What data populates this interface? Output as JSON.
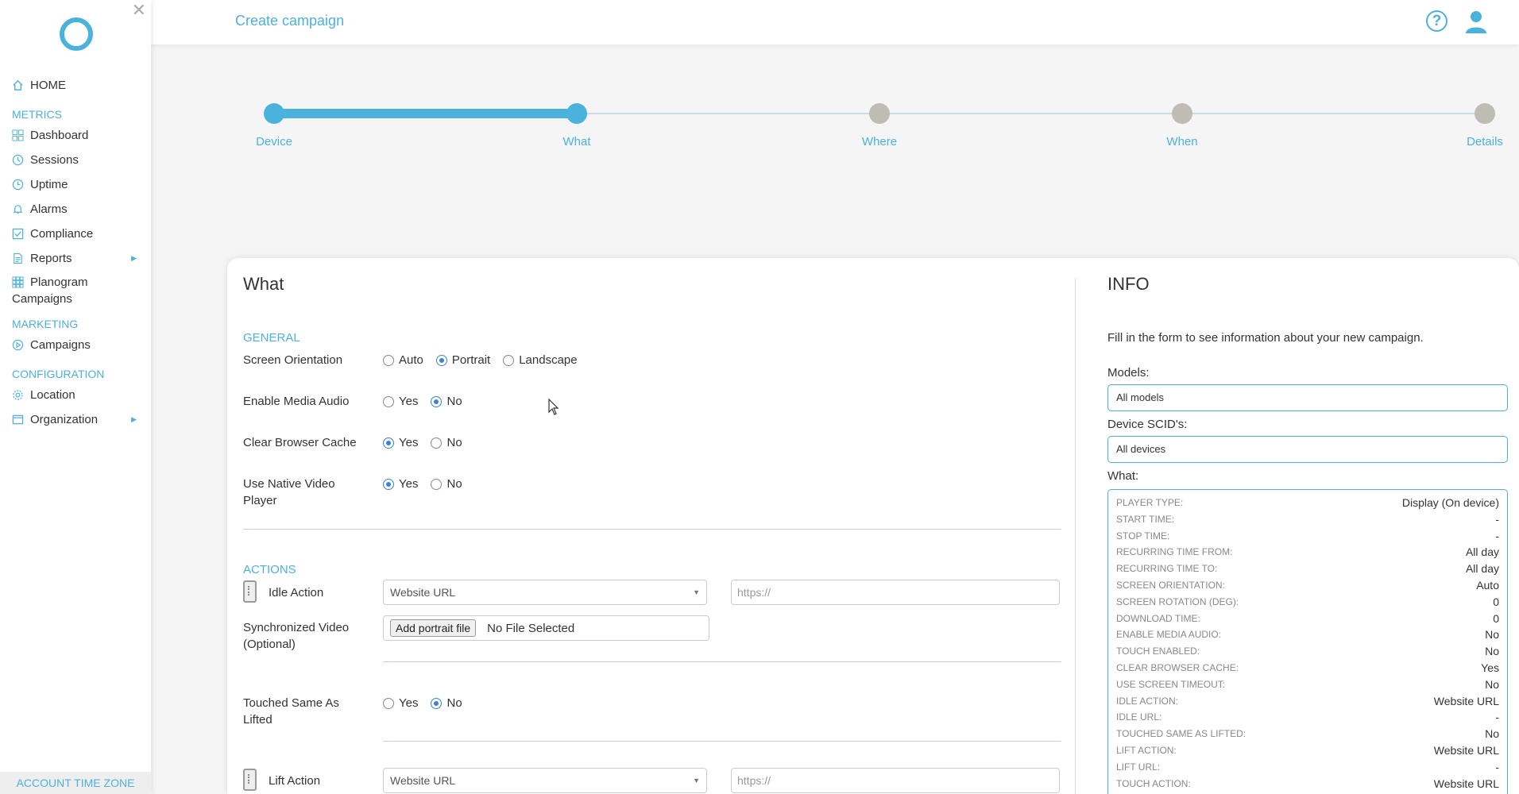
{
  "sidebar": {
    "home": "HOME",
    "sections": {
      "metrics": "METRICS",
      "marketing": "MARKETING",
      "configuration": "CONFIGURATION"
    },
    "metrics_items": [
      "Dashboard",
      "Sessions",
      "Uptime",
      "Alarms",
      "Compliance",
      "Reports"
    ],
    "planogram_line1": "Planogram",
    "planogram_line2": "Campaigns",
    "marketing_items": [
      "Campaigns"
    ],
    "configuration_items": [
      "Location",
      "Organization"
    ],
    "account_time_zone": "ACCOUNT TIME ZONE"
  },
  "header": {
    "title": "Create campaign",
    "help_glyph": "?"
  },
  "stepper": {
    "steps": [
      "Device",
      "What",
      "Where",
      "When",
      "Details"
    ],
    "current_step": 2
  },
  "form": {
    "title": "What",
    "general_section": "GENERAL",
    "screen_orientation": {
      "label": "Screen Orientation",
      "options": [
        "Auto",
        "Portrait",
        "Landscape"
      ],
      "selected": "Portrait"
    },
    "enable_media_audio": {
      "label": "Enable Media Audio",
      "options": [
        "Yes",
        "No"
      ],
      "selected": "No"
    },
    "clear_browser_cache": {
      "label": "Clear Browser Cache",
      "options": [
        "Yes",
        "No"
      ],
      "selected": "Yes"
    },
    "use_native_video_player": {
      "label_line1": "Use Native Video",
      "label_line2": "Player",
      "options": [
        "Yes",
        "No"
      ],
      "selected": "Yes"
    },
    "actions_section": "ACTIONS",
    "idle_action": {
      "label": "Idle Action",
      "select_value": "Website URL",
      "url_placeholder": "https://"
    },
    "synchronized_video": {
      "label_line1": "Synchronized Video",
      "label_line2": "(Optional)",
      "button": "Add portrait file",
      "status": "No File Selected"
    },
    "touched_same_as_lifted": {
      "label_line1": "Touched Same As",
      "label_line2": "Lifted",
      "options": [
        "Yes",
        "No"
      ],
      "selected": "No"
    },
    "lift_action": {
      "label": "Lift Action",
      "select_value": "Website URL",
      "url_placeholder": "https://"
    }
  },
  "info": {
    "title": "INFO",
    "description": "Fill in the form to see information about your new campaign.",
    "models_label": "Models:",
    "models_value": "All models",
    "device_scids_label": "Device SCID's:",
    "device_scids_value": "All devices",
    "what_label": "What:",
    "summary": [
      {
        "k": "PLAYER TYPE:",
        "v": "Display (On device)"
      },
      {
        "k": "START TIME:",
        "v": "-"
      },
      {
        "k": "STOP TIME:",
        "v": "-"
      },
      {
        "k": "RECURRING TIME FROM:",
        "v": "All day"
      },
      {
        "k": "RECURRING TIME TO:",
        "v": "All day"
      },
      {
        "k": "SCREEN ORIENTATION:",
        "v": "Auto"
      },
      {
        "k": "SCREEN ROTATION (DEG):",
        "v": "0"
      },
      {
        "k": "DOWNLOAD TIME:",
        "v": "0"
      },
      {
        "k": "ENABLE MEDIA AUDIO:",
        "v": "No"
      },
      {
        "k": "TOUCH ENABLED:",
        "v": "No"
      },
      {
        "k": "CLEAR BROWSER CACHE:",
        "v": "Yes"
      },
      {
        "k": "USE SCREEN TIMEOUT:",
        "v": "No"
      },
      {
        "k": "IDLE ACTION:",
        "v": "Website URL"
      },
      {
        "k": "IDLE URL:",
        "v": "-"
      },
      {
        "k": "TOUCHED SAME AS LIFTED:",
        "v": "No"
      },
      {
        "k": "LIFT ACTION:",
        "v": "Website URL"
      },
      {
        "k": "LIFT URL:",
        "v": "-"
      },
      {
        "k": "TOUCH ACTION:",
        "v": "Website URL"
      }
    ]
  },
  "colors": {
    "accent": "#4bb2de",
    "radio_selected": "#3b82d6",
    "step_inactive": "#bfbcb4"
  }
}
